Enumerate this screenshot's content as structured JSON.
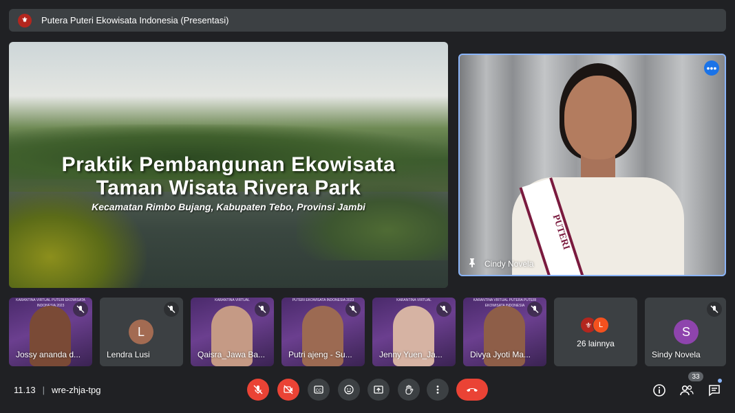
{
  "meeting": {
    "title": "Putera Puteri Ekowisata Indonesia (Presentasi)",
    "time": "11.13",
    "code": "wre-zhja-tpg",
    "participant_count": "33"
  },
  "presentation": {
    "title_line1": "Praktik Pembangunan Ekowisata",
    "title_line2": "Taman Wisata Rivera Park",
    "subtitle": "Kecamatan Rimbo Bujang, Kabupaten Tebo, Provinsi Jambi"
  },
  "speaker": {
    "name": "Cindy Novela",
    "sash_text": "PUTERI",
    "more_icon": "more-horiz-icon"
  },
  "tiles": [
    {
      "name": "Jossy ananda d...",
      "type": "video",
      "muted": true,
      "banner": "KARANTINA VIRTUAL PUTERI EKOWISATA INDONESIA 2023"
    },
    {
      "name": "Lendra Lusi",
      "type": "avatar",
      "initial": "L",
      "color": "#a36b52",
      "muted": true
    },
    {
      "name": "Qaisra_Jawa Ba...",
      "type": "video",
      "muted": true,
      "banner": "KARANTINA VIRTUAL"
    },
    {
      "name": "Putri ajeng - Su...",
      "type": "video",
      "muted": true,
      "banner": "PUTERI EKOWISATA INDONESIA 2023"
    },
    {
      "name": "Jenny Yuen_Ja...",
      "type": "video",
      "muted": true,
      "banner": "KARANTINA VIRTUAL"
    },
    {
      "name": "Divya Jyoti Ma...",
      "type": "video",
      "muted": true,
      "banner": "KARANTINA VIRTUAL PUTERA PUTERI EKOWISATA INDONESIA"
    },
    {
      "name": "26 lainnya",
      "type": "others",
      "initial": "L"
    },
    {
      "name": "Sindy Novela",
      "type": "avatar",
      "initial": "S",
      "color": "#8e44ad",
      "muted": true
    }
  ],
  "controls": {
    "mic": "mic-off-icon",
    "camera": "camera-off-icon",
    "captions": "captions-icon",
    "reactions": "emoji-icon",
    "present": "present-screen-icon",
    "raise_hand": "raise-hand-icon",
    "more": "more-vert-icon",
    "end_call": "end-call-icon"
  },
  "colors": {
    "background": "#202124",
    "accent_blue": "#8ab4f8",
    "danger_red": "#ea4335"
  }
}
